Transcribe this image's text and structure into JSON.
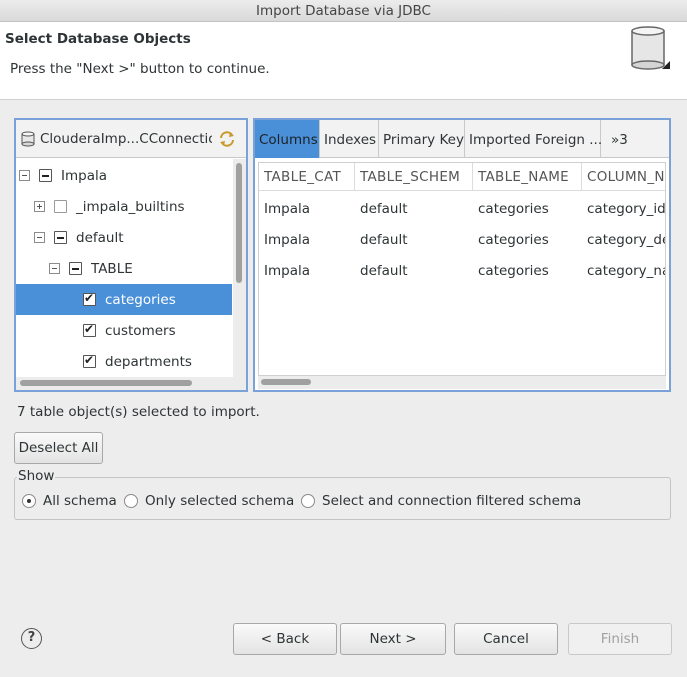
{
  "window": {
    "title": "Import Database via JDBC"
  },
  "banner": {
    "heading": "Select Database Objects",
    "message": "Press the \"Next >\" button to continue."
  },
  "connection": {
    "label": "ClouderaImp...CConnectio"
  },
  "tree": {
    "rows": [
      {
        "label": "Impala",
        "expander": "minus",
        "checkbox": "partial"
      },
      {
        "label": "_impala_builtins",
        "expander": "plus",
        "checkbox": "unchecked"
      },
      {
        "label": "default",
        "expander": "minus",
        "checkbox": "partial"
      },
      {
        "label": "TABLE",
        "expander": "minus",
        "checkbox": "partial"
      },
      {
        "label": "categories",
        "expander": "none",
        "checkbox": "checked",
        "selected": true
      },
      {
        "label": "customers",
        "expander": "none",
        "checkbox": "checked"
      },
      {
        "label": "departments",
        "expander": "none",
        "checkbox": "checked"
      }
    ]
  },
  "tabs": [
    "Columns",
    "Indexes",
    "Primary Key",
    "Imported Foreign ...",
    "»3"
  ],
  "grid": {
    "headers": [
      "TABLE_CAT",
      "TABLE_SCHEM",
      "TABLE_NAME",
      "COLUMN_N"
    ],
    "rows": [
      [
        "Impala",
        "default",
        "categories",
        "category_id"
      ],
      [
        "Impala",
        "default",
        "categories",
        "category_de"
      ],
      [
        "Impala",
        "default",
        "categories",
        "category_na"
      ]
    ]
  },
  "status": "7 table object(s) selected to import.",
  "buttons": {
    "deselect_all": "Deselect All",
    "back": "< Back",
    "next": "Next >",
    "cancel": "Cancel",
    "finish": "Finish"
  },
  "show_group": {
    "legend": "Show",
    "options": [
      "All schema",
      "Only selected schema",
      "Select and connection filtered schema"
    ],
    "selected": "All schema"
  },
  "help_label": "?"
}
